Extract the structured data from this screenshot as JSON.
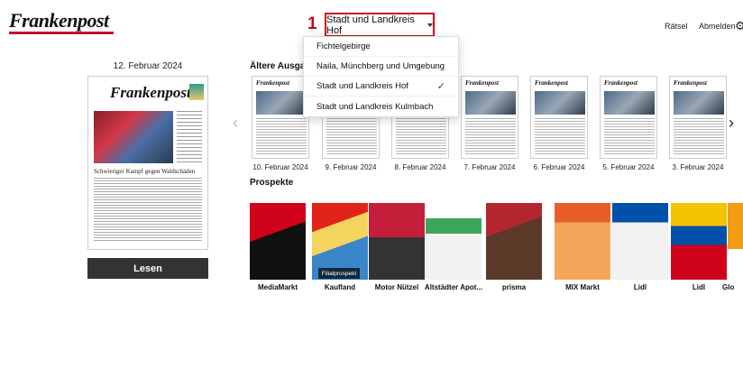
{
  "header": {
    "logo": "Frankenpost",
    "step_number": "1",
    "region_selected": "Stadt und Landkreis Hof",
    "raetsel": "Rätsel",
    "abmelden": "Abmelden"
  },
  "dropdown": {
    "items": [
      {
        "label": "Fichtelgebirge",
        "selected": false
      },
      {
        "label": "Naila, Münchberg und Umgebung",
        "selected": false
      },
      {
        "label": "Stadt und Landkreis Hof",
        "selected": true
      },
      {
        "label": "Stadt und Landkreis Kulmbach",
        "selected": false
      }
    ],
    "check_glyph": "✓"
  },
  "current": {
    "date": "12. Februar 2024",
    "masthead": "Frankenpost",
    "headline": "Schwieriger Kampf gegen Waldschäden",
    "read_label": "Lesen"
  },
  "older": {
    "title": "Ältere Ausgaben",
    "editions": [
      {
        "date": "10. Februar 2024"
      },
      {
        "date": "9. Februar 2024"
      },
      {
        "date": "8. Februar 2024"
      },
      {
        "date": "7. Februar 2024"
      },
      {
        "date": "6. Februar 2024"
      },
      {
        "date": "5. Februar 2024"
      },
      {
        "date": "3. Februar 2024"
      }
    ]
  },
  "prospekte": {
    "title": "Prospekte",
    "filial_badge": "Filialprospekt",
    "items": [
      {
        "label": "MediaMarkt",
        "color": "#d0021b"
      },
      {
        "label": "Kaufland",
        "color": "#e2231a"
      },
      {
        "label": "Motor Nützel",
        "color": "#c41e3a"
      },
      {
        "label": "Altstädter Apot...",
        "color": "#3ca55c"
      },
      {
        "label": "prisma",
        "color": "#b3262f"
      },
      {
        "label": "MIX Markt",
        "color": "#e85d2a"
      },
      {
        "label": "Lidl",
        "color": "#0050aa"
      },
      {
        "label": "Lidl",
        "color": "#f5c400"
      },
      {
        "label": "Glo",
        "color": "#f39c12"
      }
    ]
  }
}
